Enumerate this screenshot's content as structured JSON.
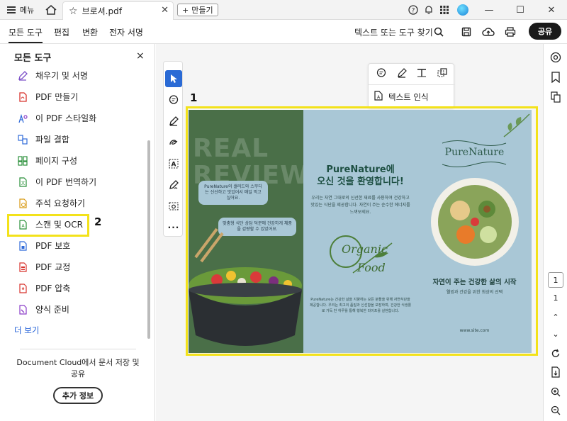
{
  "titlebar": {
    "menu_label": "메뉴",
    "tab_title": "브로셔.pdf",
    "new_tab_label": "만들기"
  },
  "menubar": {
    "tabs": [
      "모든 도구",
      "편집",
      "변환",
      "전자 서명"
    ],
    "search_label": "텍스트 또는 도구 찾기",
    "share_label": "공유"
  },
  "leftpanel": {
    "title": "모든 도구",
    "tools": [
      {
        "label": "채우기 및 서명",
        "icon": "pen-icon",
        "color": "#7b4fc8"
      },
      {
        "label": "PDF 만들기",
        "icon": "pdf-create-icon",
        "color": "#d8342e"
      },
      {
        "label": "이 PDF 스타일화",
        "icon": "stylize-icon",
        "color": "#2f6ad9"
      },
      {
        "label": "파일 결합",
        "icon": "combine-icon",
        "color": "#2f6ad9"
      },
      {
        "label": "페이지 구성",
        "icon": "organize-pages-icon",
        "color": "#2a8f3a"
      },
      {
        "label": "이 PDF 번역하기",
        "icon": "translate-icon",
        "color": "#2a8f3a"
      },
      {
        "label": "주석 요청하기",
        "icon": "request-comments-icon",
        "color": "#d89a14"
      },
      {
        "label": "스캔 및 OCR",
        "icon": "scan-ocr-icon",
        "color": "#2a8f3a"
      },
      {
        "label": "PDF 보호",
        "icon": "protect-icon",
        "color": "#2f6ad9"
      },
      {
        "label": "PDF 교정",
        "icon": "redact-icon",
        "color": "#d8342e"
      },
      {
        "label": "PDF 압축",
        "icon": "compress-icon",
        "color": "#d8342e"
      },
      {
        "label": "양식 준비",
        "icon": "prepare-form-icon",
        "color": "#8a3cc8"
      }
    ],
    "more_label": "더 보기",
    "cloud_text": "Document Cloud에서 문서 저장 및 공유",
    "info_button": "추가 정보"
  },
  "callouts": {
    "one": "1",
    "two": "2"
  },
  "context_menu": {
    "icons": [
      "comment-icon",
      "highlight-pen-icon",
      "text-edit-icon",
      "crop-icon"
    ],
    "item_label": "텍스트 인식"
  },
  "brochure": {
    "bg_text_1": "REAL",
    "bg_text_2": "REVIEW",
    "bubble1": "PureNature의 샐러드와 스무디는 신선하고 맛있어서 매일 먹고 싶어요.",
    "bubble2": "맞춤형 식단 상담 덕분에 건강하게 체중을 감량할 수 있었어요.",
    "p2_title_1": "PureNature에",
    "p2_title_2": "오신 것을 환영합니다!",
    "p2_body": "우리는 자연 그대로의 신선한 재료를 사용하여 건강하고 맛있는 식단을 제공합니다. 자연이 주는 순수한 에너지를 느껴보세요.",
    "organic_1": "Organic",
    "organic_2": "Food",
    "p2_foot": "PureNature는 건강한 삶을 지향하는 모든 분들을 위해 자연식단을 제공합니다. 우리는 최고의 품질과 신선함을 보장하며, 건강한 식생활로 가득 찬 하루를 통해 행복한 라이프를 실현합니다.",
    "brand": "PureNature",
    "tagline": "자연이 주는 건강한 삶의 시작",
    "subline": "웰빙과 건강을 위한 최상의 선택",
    "site": "www.site.com"
  },
  "pagination": {
    "current": "1",
    "total": "1"
  },
  "colors": {
    "accent_blue": "#2a6ad5",
    "highlight_yellow": "#f3e21a",
    "panel_green": "#4a6f48",
    "panel_blue": "#a9c7d6"
  }
}
